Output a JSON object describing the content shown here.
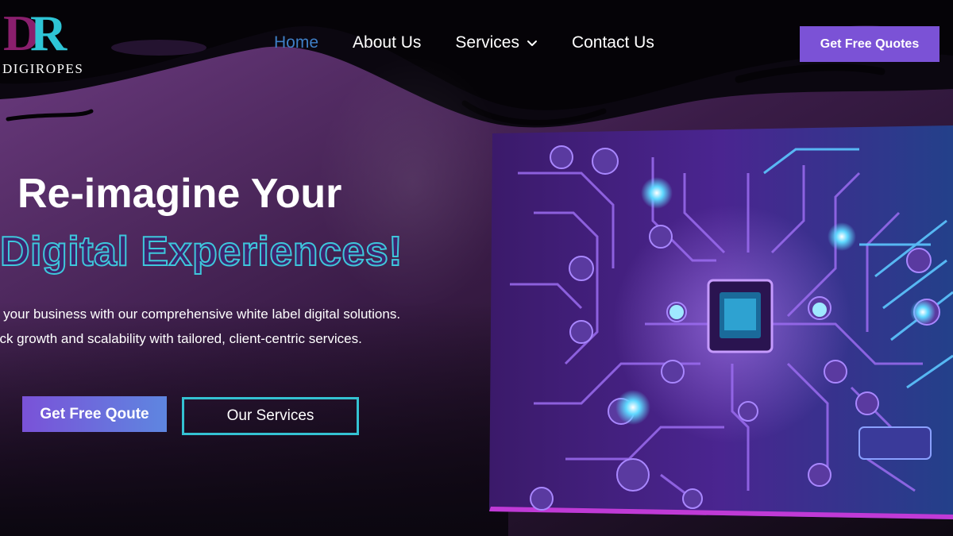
{
  "brand": {
    "logo_letters": [
      "D",
      "R"
    ],
    "name": "DIGIROPES"
  },
  "nav": {
    "items": [
      {
        "label": "Home",
        "active": true
      },
      {
        "label": "About Us",
        "active": false
      },
      {
        "label": "Services",
        "active": false,
        "has_dropdown": true
      },
      {
        "label": "Contact Us",
        "active": false
      }
    ],
    "cta_label": "Get Free Quotes"
  },
  "hero": {
    "title": "Re-imagine Your",
    "subtitle": "Digital Experiences!",
    "description_lines": [
      "n your business with our comprehensive white label digital solutions.",
      "ock growth and scalability with tailored, client-centric services."
    ],
    "primary_button": "Get Free Qoute",
    "secondary_button": "Our Services"
  },
  "icons": {
    "dropdown": "chevron-down-icon"
  },
  "colors": {
    "accent_purple": "#7b52d6",
    "accent_cyan": "#34c2d2",
    "active_nav": "#3f7fc6",
    "background": "#0b0710"
  }
}
